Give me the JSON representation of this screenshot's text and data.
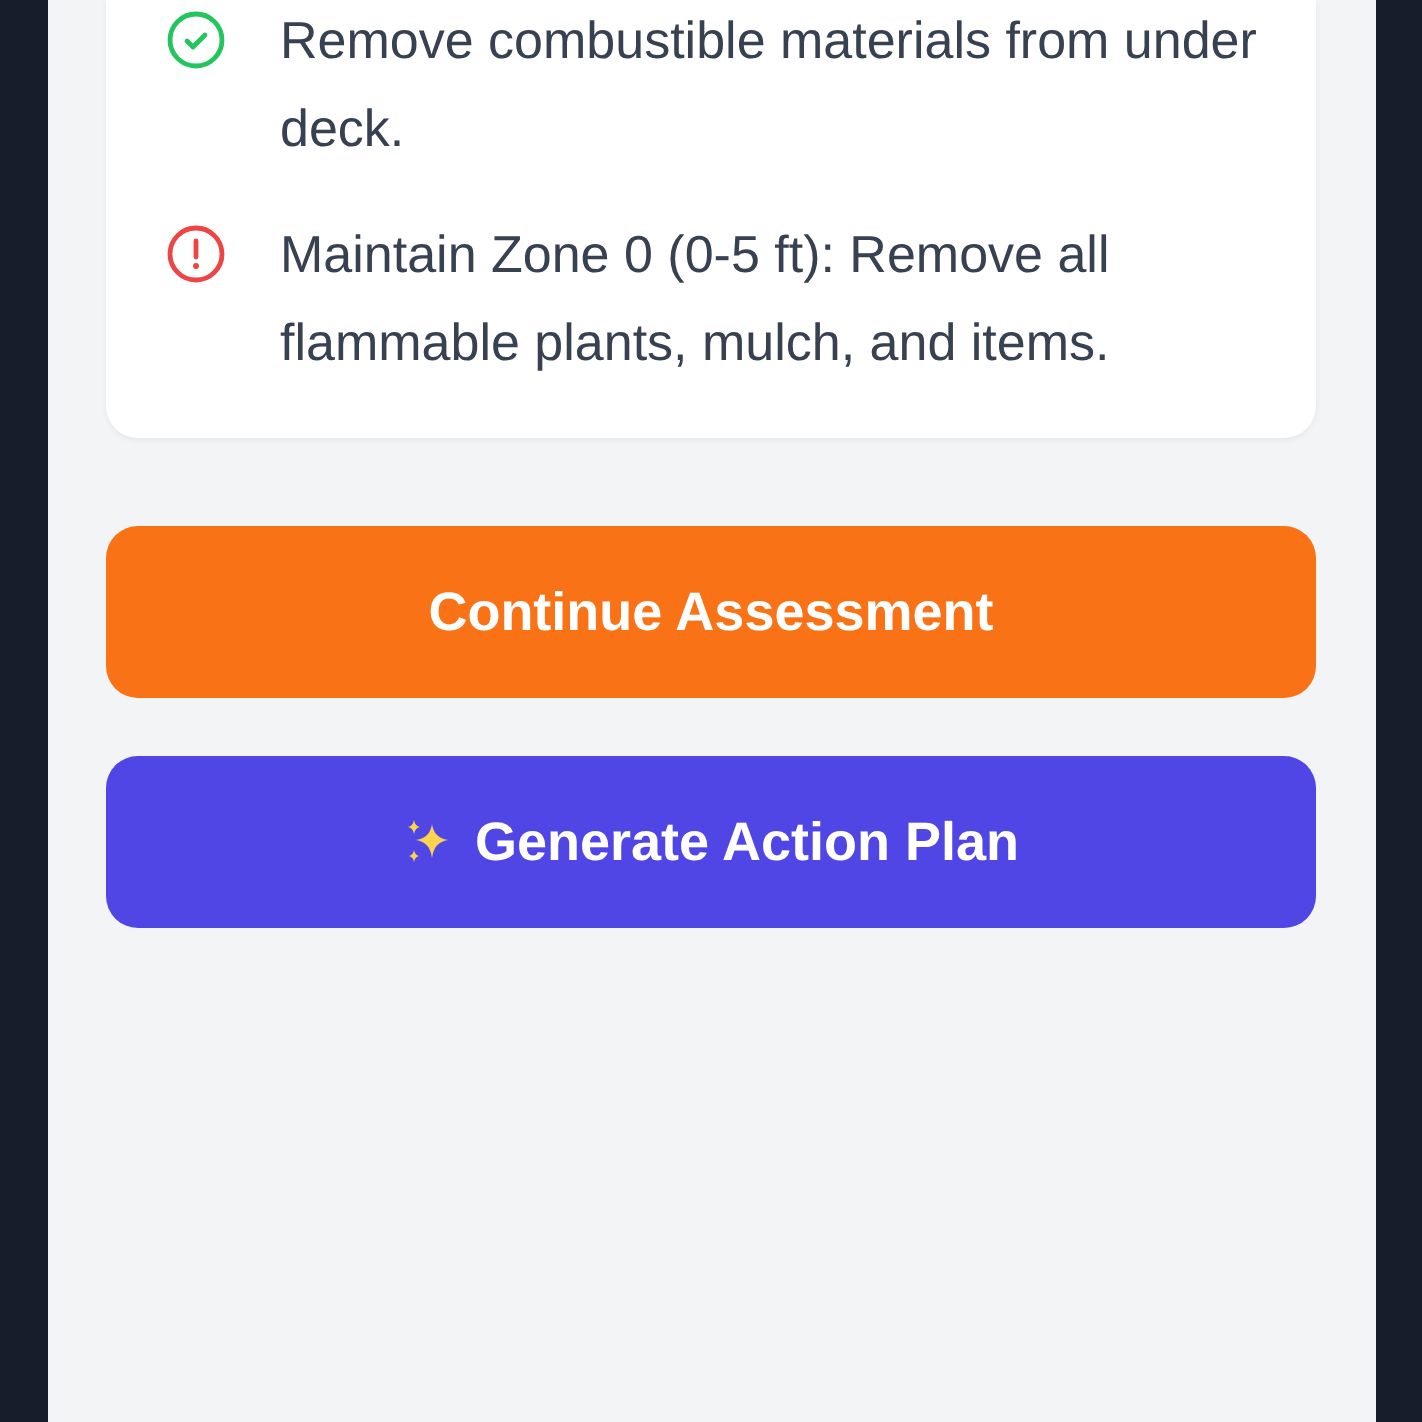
{
  "checklist": [
    {
      "kind": "done",
      "text": "Remove combustible materials from under deck."
    },
    {
      "kind": "warning",
      "text": "Maintain Zone 0 (0-5 ft): Remove all flammable plants, mulch, and items."
    }
  ],
  "buttons": [
    {
      "kind": "primary",
      "label": "Continue Assessment"
    },
    {
      "kind": "ai",
      "label": "Generate Action Plan"
    }
  ]
}
